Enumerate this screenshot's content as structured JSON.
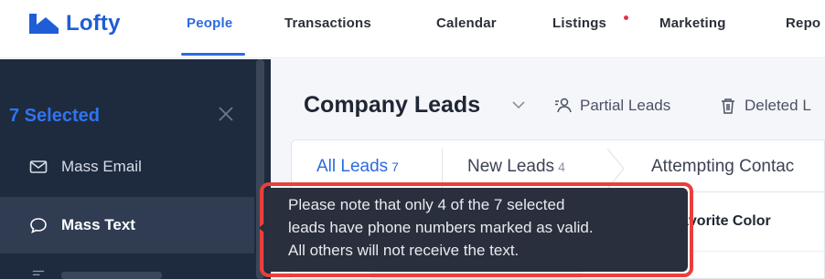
{
  "brand": {
    "name": "Lofty",
    "color": "#1f5dd6"
  },
  "nav": {
    "items": [
      {
        "label": "People",
        "active": true
      },
      {
        "label": "Transactions"
      },
      {
        "label": "Calendar"
      },
      {
        "label": "Listings",
        "badge": "dot"
      },
      {
        "label": "Marketing"
      },
      {
        "label": "Repo"
      }
    ]
  },
  "sidebar": {
    "selected_label": "7 Selected",
    "close_icon": "close-icon",
    "actions": [
      {
        "label": "Mass Email",
        "icon": "mail-icon"
      },
      {
        "label": "Mass Text",
        "icon": "chat-bubble-icon",
        "active": true
      }
    ]
  },
  "main": {
    "title": "Company Leads",
    "tools": [
      {
        "label": "Partial Leads",
        "icon": "partial-users-icon"
      },
      {
        "label": "Deleted L",
        "icon": "trash-icon"
      }
    ],
    "tabs": [
      {
        "label": "All Leads",
        "count": "7",
        "active": true
      },
      {
        "label": "New Leads",
        "count": "4"
      },
      {
        "label": "Attempting Contac",
        "count": ""
      }
    ],
    "column_header": "avorite Color"
  },
  "tooltip": {
    "text": "Please note that only 4 of the 7 selected\nleads have phone numbers marked as valid.\nAll others will not receive the text.",
    "highlight_color": "#e8403a"
  },
  "colors": {
    "accent": "#2c6be0",
    "sidebar_bg": "#1e2a3e",
    "alert_dot": "#e8304a"
  }
}
